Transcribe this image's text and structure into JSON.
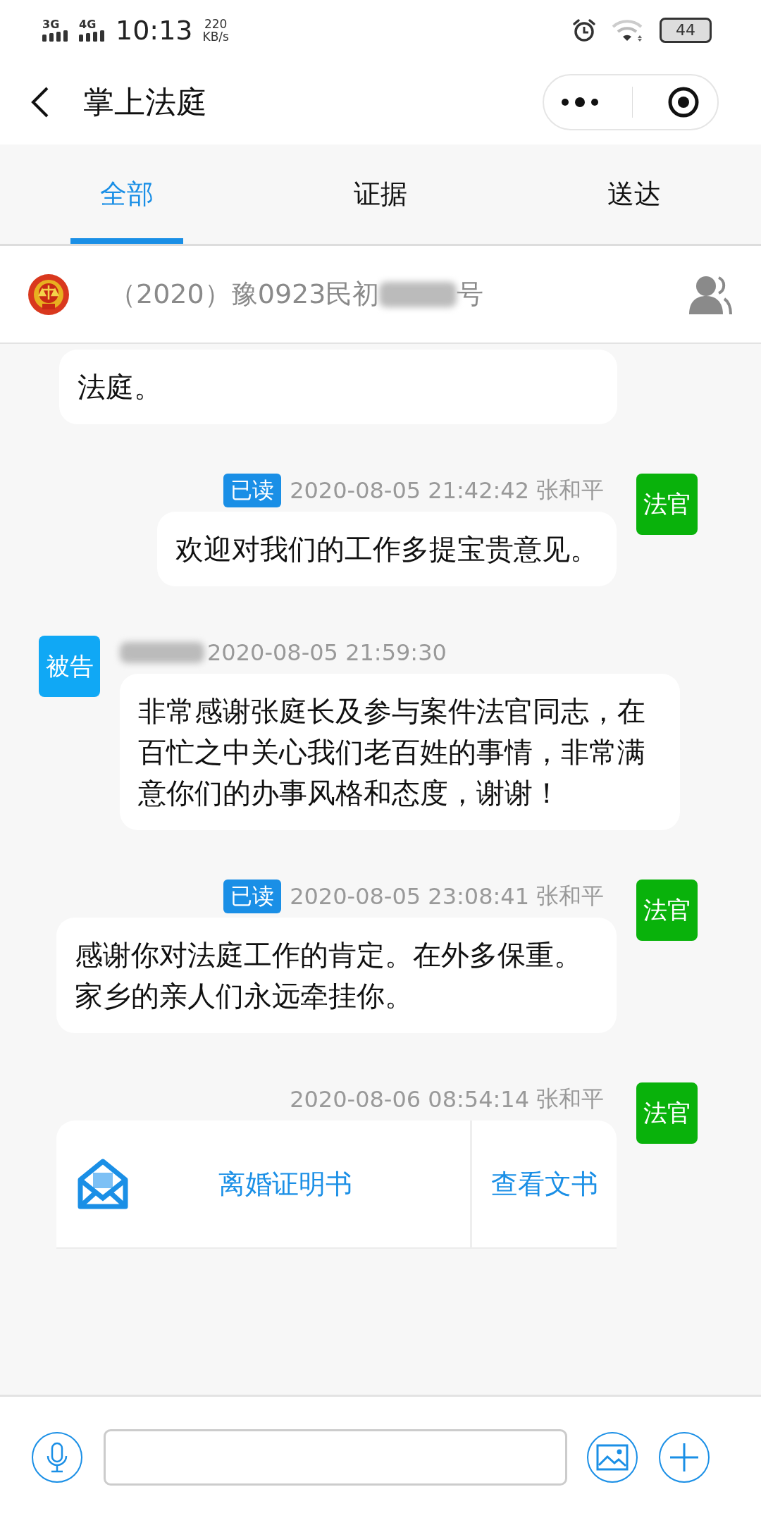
{
  "status_bar": {
    "networks": [
      "3G",
      "4G"
    ],
    "time": "10:13",
    "speed": "220",
    "speed_unit": "KB/s",
    "battery": "44"
  },
  "header": {
    "title": "掌上法庭"
  },
  "tabs": [
    {
      "label": "全部",
      "selected": true
    },
    {
      "label": "证据",
      "selected": false
    },
    {
      "label": "送达",
      "selected": false
    }
  ],
  "case_bar": {
    "number_prefix": "（2020）豫0923民初",
    "number_redacted": true,
    "number_suffix": "号"
  },
  "top_fragment": {
    "text": "法庭。"
  },
  "messages": [
    {
      "outgoing": true,
      "avatar": "法官",
      "color": "#09b20b",
      "read": true,
      "read_label": "已读",
      "time": "2020-08-05 21:42:42",
      "name": "张和平",
      "kind": "text",
      "text": "欢迎对我们的工作多提宝贵意见。"
    },
    {
      "outgoing": false,
      "avatar": "被告",
      "color": "#10a8f5",
      "sender_redacted": true,
      "time": "2020-08-05 21:59:30",
      "kind": "text",
      "text": "非常感谢张庭长及参与案件法官同志，在百忙之中关心我们老百姓的事情，非常满意你们的办事风格和态度，谢谢！"
    },
    {
      "outgoing": true,
      "avatar": "法官",
      "color": "#09b20b",
      "read": true,
      "read_label": "已读",
      "time": "2020-08-05 23:08:41",
      "name": "张和平",
      "kind": "text",
      "text": "感谢你对法庭工作的肯定。在外多保重。家乡的亲人们永远牵挂你。"
    },
    {
      "outgoing": true,
      "avatar": "法官",
      "color": "#09b20b",
      "time": "2020-08-06 08:54:14",
      "name": "张和平",
      "kind": "document",
      "document": {
        "title": "离婚证明书",
        "action": "查看文书"
      }
    }
  ]
}
